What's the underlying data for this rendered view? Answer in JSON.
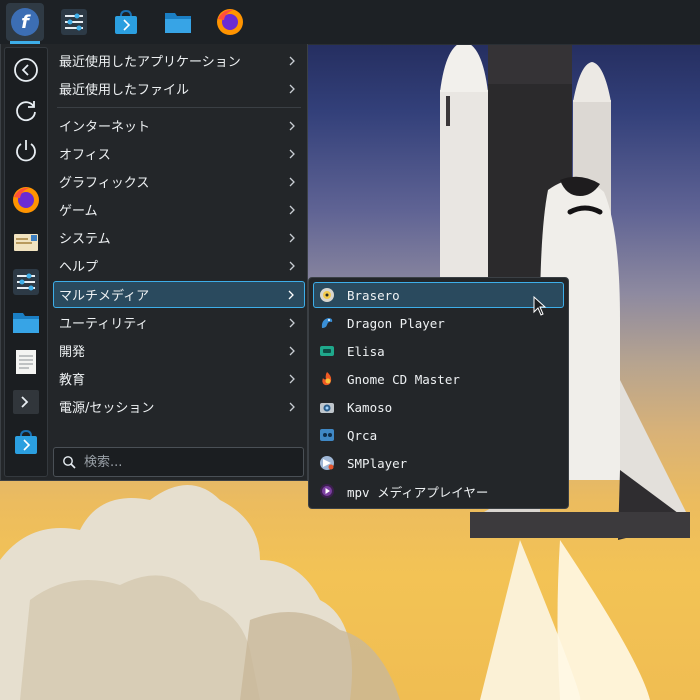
{
  "panel": {
    "items": [
      {
        "name": "fedora-launcher-icon"
      },
      {
        "name": "system-settings-icon"
      },
      {
        "name": "discover-store-icon"
      },
      {
        "name": "file-manager-icon"
      },
      {
        "name": "firefox-icon"
      }
    ]
  },
  "sidebar": {
    "items": [
      {
        "name": "logout-icon"
      },
      {
        "name": "restart-icon"
      },
      {
        "name": "shutdown-icon"
      },
      {
        "name": "firefox-icon"
      },
      {
        "name": "mail-icon"
      },
      {
        "name": "system-settings-icon"
      },
      {
        "name": "file-manager-icon"
      },
      {
        "name": "text-editor-icon"
      },
      {
        "name": "terminal-icon"
      },
      {
        "name": "discover-store-icon"
      }
    ]
  },
  "menu": {
    "recent": [
      {
        "label": "最近使用したアプリケーション"
      },
      {
        "label": "最近使用したファイル"
      }
    ],
    "categories": [
      {
        "label": "インターネット"
      },
      {
        "label": "オフィス"
      },
      {
        "label": "グラフィックス"
      },
      {
        "label": "ゲーム"
      },
      {
        "label": "システム"
      },
      {
        "label": "ヘルプ"
      },
      {
        "label": "マルチメディア",
        "selected": true
      },
      {
        "label": "ユーティリティ"
      },
      {
        "label": "開発"
      },
      {
        "label": "教育"
      },
      {
        "label": "電源/セッション"
      }
    ],
    "search": {
      "placeholder": "検索..."
    }
  },
  "submenu": {
    "items": [
      {
        "label": "Brasero",
        "icon": "brasero-disc-icon",
        "hover": true
      },
      {
        "label": "Dragon Player",
        "icon": "dragon-player-icon"
      },
      {
        "label": "Elisa",
        "icon": "elisa-icon"
      },
      {
        "label": "Gnome CD Master",
        "icon": "gnome-cd-master-icon"
      },
      {
        "label": "Kamoso",
        "icon": "kamoso-camera-icon"
      },
      {
        "label": "Qrca",
        "icon": "qrca-icon"
      },
      {
        "label": "SMPlayer",
        "icon": "smplayer-icon"
      },
      {
        "label": "mpv メディアプレイヤー",
        "icon": "mpv-icon"
      }
    ]
  },
  "colors": {
    "accent": "#3daee9",
    "menu_bg": "#232629",
    "panel_bg": "#1d2125"
  }
}
